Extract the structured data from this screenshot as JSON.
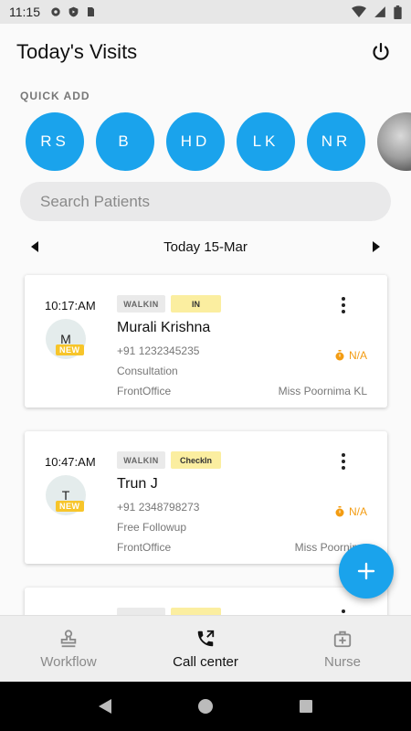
{
  "status_bar": {
    "time": "11:15"
  },
  "header": {
    "title": "Today's Visits"
  },
  "quick_add": {
    "label": "QUICK ADD",
    "items": [
      "RS",
      "B",
      "HD",
      "LK",
      "NR"
    ]
  },
  "search": {
    "placeholder": "Search Patients"
  },
  "date_nav": {
    "label": "Today 15-Mar"
  },
  "visits": [
    {
      "time": "10:17:AM",
      "initial": "M",
      "badge": "NEW",
      "visit_type": "WALKIN",
      "status": "IN",
      "name": "Murali Krishna",
      "phone": "+91 1232345235",
      "consult_type": "Consultation",
      "department": "FrontOffice",
      "doctor": "Miss Poornima KL",
      "wait": "N/A"
    },
    {
      "time": "10:47:AM",
      "initial": "T",
      "badge": "NEW",
      "visit_type": "WALKIN",
      "status": "CheckIn",
      "name": "Trun J",
      "phone": "+91 2348798273",
      "consult_type": "Free Followup",
      "department": "FrontOffice",
      "doctor": "Miss Poornima",
      "wait": "N/A"
    }
  ],
  "bottom_nav": [
    {
      "label": "Workflow",
      "icon": "stamp-icon"
    },
    {
      "label": "Call center",
      "icon": "phone-forward-icon"
    },
    {
      "label": "Nurse",
      "icon": "medical-kit-icon"
    }
  ],
  "colors": {
    "accent": "#1aa3ec",
    "badge_new": "#f7c52a",
    "status_tag": "#fbeea0",
    "wait": "#f39c12"
  }
}
